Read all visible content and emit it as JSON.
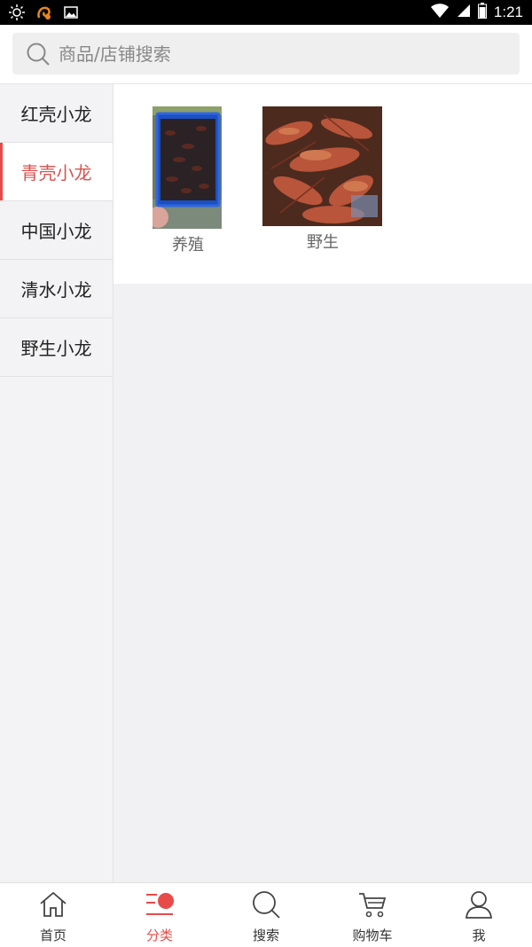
{
  "status_bar": {
    "time": "1:21"
  },
  "search": {
    "placeholder": "商品/店铺搜索"
  },
  "categories": [
    {
      "label": "红壳小龙",
      "active": false
    },
    {
      "label": "青壳小龙",
      "active": true
    },
    {
      "label": "中国小龙",
      "active": false
    },
    {
      "label": "清水小龙",
      "active": false
    },
    {
      "label": "野生小龙",
      "active": false
    }
  ],
  "products": [
    {
      "label": "养殖"
    },
    {
      "label": "野生"
    }
  ],
  "tabbar": {
    "items": [
      {
        "label": "首页",
        "icon": "home-icon"
      },
      {
        "label": "分类",
        "icon": "category-icon"
      },
      {
        "label": "搜索",
        "icon": "search-icon"
      },
      {
        "label": "购物车",
        "icon": "cart-icon"
      },
      {
        "label": "我",
        "icon": "user-icon"
      }
    ]
  },
  "colors": {
    "accent": "#e84a4a",
    "active_text": "#d9534f"
  }
}
